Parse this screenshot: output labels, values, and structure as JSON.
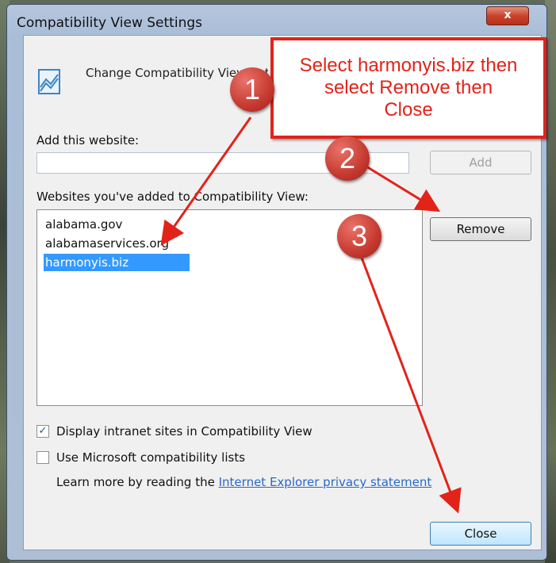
{
  "window": {
    "title": "Compatibility View Settings",
    "close_glyph": "x"
  },
  "header": {
    "icon": "compatibility-view-icon",
    "text": "Change Compatibility View Settings"
  },
  "add_site": {
    "label": "Add this website:",
    "value": "",
    "button_label": "Add"
  },
  "sites": {
    "label": "Websites you've added to Compatibility View:",
    "items": [
      "alabama.gov",
      "alabamaservices.org",
      "harmonyis.biz"
    ],
    "selected": "harmonyis.biz",
    "remove_label": "Remove"
  },
  "options": {
    "intranet_label": "Display intranet sites in Compatibility View",
    "intranet_checked": true,
    "ms_lists_label": "Use Microsoft compatibility lists",
    "ms_lists_checked": false,
    "learn_more_text": "Learn more by reading the",
    "privacy_link": "Internet Explorer privacy statement"
  },
  "close_label": "Close",
  "annotation": {
    "callout_line1": "Select harmonyis.biz then",
    "callout_line2": "select Remove then",
    "callout_line3": "Close",
    "steps": [
      "1",
      "2",
      "3"
    ],
    "color": "#e2231a"
  }
}
